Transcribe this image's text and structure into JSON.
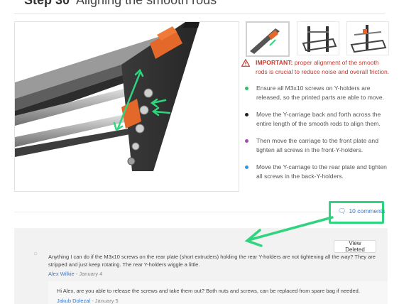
{
  "step": {
    "label": "Step 30",
    "title": "Aligning the smooth rods"
  },
  "thumbnails": [
    {
      "name": "thumbnail-1",
      "active": true
    },
    {
      "name": "thumbnail-2",
      "active": false
    },
    {
      "name": "thumbnail-3",
      "active": false
    }
  ],
  "important": {
    "label": "IMPORTANT:",
    "text": " proper alignment of the smooth rods is crucial to reduce noise and overall friction."
  },
  "bullets": [
    {
      "color": "#2ebf6b",
      "text": "Ensure all M3x10 screws on Y-holders are released, so the printed parts are able to move."
    },
    {
      "color": "#222222",
      "text": "Move the Y-carriage back and forth across the entire length of the smooth rods to align them."
    },
    {
      "color": "#a04bb0",
      "text": "Then move the carriage to the front plate and tighten all screws in the front-Y-holders."
    },
    {
      "color": "#2a9ad9",
      "text": "Move the Y-carriage to the rear plate and tighten all screws in the back-Y-holders."
    }
  ],
  "comments": {
    "link_label": "10 comments",
    "view_deleted_label": "View Deleted",
    "items": [
      {
        "text": "Anything I can do if the M3x10 screws on the rear plate (short extruders) holding the rear Y-holders are not tightening all the way? They are stripped and just keep rotating. The rear Y-holders wiggle a little.",
        "author": "Alex Wilkie",
        "date": " - January 4"
      }
    ],
    "reply": {
      "text": "Hi Alex, are you able to release the screws and take them out? Both nuts and screws, can be replaced from spare bag if needed.",
      "author": "Jakub Dolezal",
      "date": " - January 5"
    }
  },
  "colors": {
    "accent_highlight": "#2ed47e",
    "link": "#3b79c8",
    "warning": "#c7382e"
  }
}
